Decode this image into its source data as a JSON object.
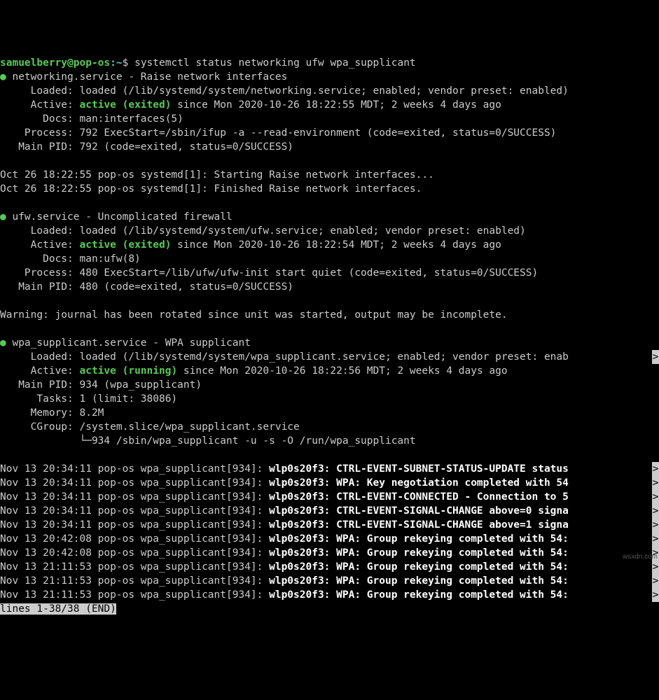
{
  "prompt": {
    "user": "samuelberry",
    "at": "@",
    "host": "pop-os",
    "sep1": ":",
    "cwd": "~",
    "sep2": "$",
    "command": "systemctl status networking ufw wpa_supplicant"
  },
  "services": {
    "networking": {
      "bullet": "●",
      "title": " networking.service - Raise network interfaces",
      "loaded": "     Loaded: loaded (/lib/systemd/system/networking.service; enabled; vendor preset: enabled)",
      "active_prefix": "     Active: ",
      "active_status": "active (exited)",
      "active_suffix": " since Mon 2020-10-26 18:22:55 MDT; 2 weeks 4 days ago",
      "docs": "       Docs: man:interfaces(5)",
      "process": "    Process: 792 ExecStart=/sbin/ifup -a --read-environment (code=exited, status=0/SUCCESS)",
      "mainpid": "   Main PID: 792 (code=exited, status=0/SUCCESS)",
      "log1": "Oct 26 18:22:55 pop-os systemd[1]: Starting Raise network interfaces...",
      "log2": "Oct 26 18:22:55 pop-os systemd[1]: Finished Raise network interfaces."
    },
    "ufw": {
      "bullet": "●",
      "title": " ufw.service - Uncomplicated firewall",
      "loaded": "     Loaded: loaded (/lib/systemd/system/ufw.service; enabled; vendor preset: enabled)",
      "active_prefix": "     Active: ",
      "active_status": "active (exited)",
      "active_suffix": " since Mon 2020-10-26 18:22:54 MDT; 2 weeks 4 days ago",
      "docs": "       Docs: man:ufw(8)",
      "process": "    Process: 480 ExecStart=/lib/ufw/ufw-init start quiet (code=exited, status=0/SUCCESS)",
      "mainpid": "   Main PID: 480 (code=exited, status=0/SUCCESS)",
      "warn": "Warning: journal has been rotated since unit was started, output may be incomplete."
    },
    "wpa": {
      "bullet": "●",
      "title": " wpa_supplicant.service - WPA supplicant",
      "loaded": "     Loaded: loaded (/lib/systemd/system/wpa_supplicant.service; enabled; vendor preset: enab",
      "loaded_arrow": ">",
      "active_prefix": "     Active: ",
      "active_status": "active (running)",
      "active_suffix": " since Mon 2020-10-26 18:22:56 MDT; 2 weeks 4 days ago",
      "mainpid": "   Main PID: 934 (wpa_supplicant)",
      "tasks": "      Tasks: 1 (limit: 38086)",
      "memory": "     Memory: 8.2M",
      "cgroup": "     CGroup: /system.slice/wpa_supplicant.service",
      "tree": "             └─",
      "treecmd": "934 /sbin/wpa_supplicant -u -s -O /run/wpa_supplicant",
      "logs": [
        {
          "pre": "Nov 13 20:34:11 pop-os wpa_supplicant[934]: ",
          "bold": "wlp0s20f3: CTRL-EVENT-SUBNET-STATUS-UPDATE status",
          "arrow": ">"
        },
        {
          "pre": "Nov 13 20:34:11 pop-os wpa_supplicant[934]: ",
          "bold": "wlp0s20f3: WPA: Key negotiation completed with 54",
          "arrow": ">"
        },
        {
          "pre": "Nov 13 20:34:11 pop-os wpa_supplicant[934]: ",
          "bold": "wlp0s20f3: CTRL-EVENT-CONNECTED - Connection to 5",
          "arrow": ">"
        },
        {
          "pre": "Nov 13 20:34:11 pop-os wpa_supplicant[934]: ",
          "bold": "wlp0s20f3: CTRL-EVENT-SIGNAL-CHANGE above=0 signa",
          "arrow": ">"
        },
        {
          "pre": "Nov 13 20:34:11 pop-os wpa_supplicant[934]: ",
          "bold": "wlp0s20f3: CTRL-EVENT-SIGNAL-CHANGE above=1 signa",
          "arrow": ">"
        },
        {
          "pre": "Nov 13 20:42:08 pop-os wpa_supplicant[934]: ",
          "bold": "wlp0s20f3: WPA: Group rekeying completed with 54:",
          "arrow": ">"
        },
        {
          "pre": "Nov 13 20:42:08 pop-os wpa_supplicant[934]: ",
          "bold": "wlp0s20f3: WPA: Group rekeying completed with 54:",
          "arrow": ">"
        },
        {
          "pre": "Nov 13 21:11:53 pop-os wpa_supplicant[934]: ",
          "bold": "wlp0s20f3: WPA: Group rekeying completed with 54:",
          "arrow": ">"
        },
        {
          "pre": "Nov 13 21:11:53 pop-os wpa_supplicant[934]: ",
          "bold": "wlp0s20f3: WPA: Group rekeying completed with 54:",
          "arrow": ">"
        },
        {
          "pre": "Nov 13 21:11:53 pop-os wpa_supplicant[934]: ",
          "bold": "wlp0s20f3: WPA: Group rekeying completed with 54:",
          "arrow": ">"
        }
      ]
    }
  },
  "pager": "lines 1-38/38 (END)",
  "watermark": "wsxdn.com"
}
